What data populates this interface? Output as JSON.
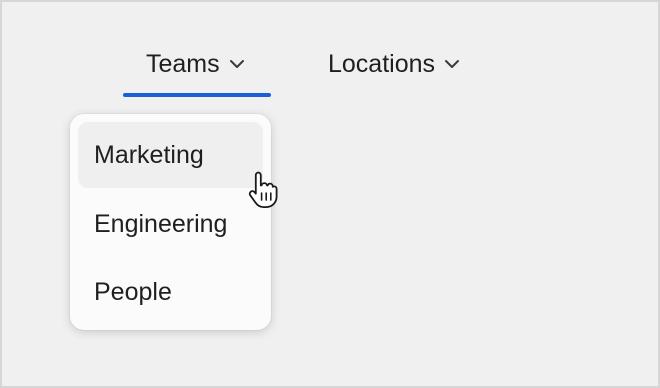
{
  "nav": {
    "tabs": [
      {
        "label": "Teams",
        "active": true,
        "icon": "chevron-down-icon"
      },
      {
        "label": "Locations",
        "active": false,
        "icon": "chevron-down-icon"
      }
    ]
  },
  "dropdown": {
    "items": [
      {
        "label": "Marketing",
        "hovered": true
      },
      {
        "label": "Engineering",
        "hovered": false
      },
      {
        "label": "People",
        "hovered": false
      }
    ]
  },
  "cursor": {
    "icon": "pointer-hand-icon"
  },
  "colors": {
    "accent": "#1a5fd6",
    "background": "#f0f0f0",
    "menu_background": "#fbfbfb",
    "hover": "#efefef",
    "text": "#1f1f1f"
  }
}
